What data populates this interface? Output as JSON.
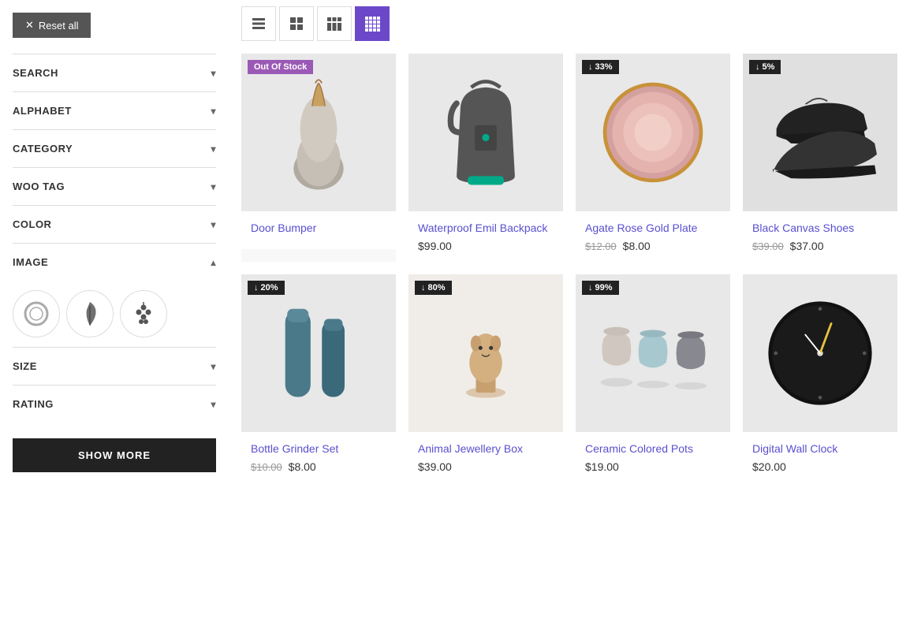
{
  "sidebar": {
    "reset_label": "Reset all",
    "filters": [
      {
        "id": "search",
        "label": "SEARCH",
        "expanded": false
      },
      {
        "id": "alphabet",
        "label": "ALPHABET",
        "expanded": false
      },
      {
        "id": "category",
        "label": "CATEGORY",
        "expanded": false
      },
      {
        "id": "woo-tag",
        "label": "WOO TAG",
        "expanded": false
      },
      {
        "id": "color",
        "label": "COLOR",
        "expanded": false
      },
      {
        "id": "image",
        "label": "IMAGE",
        "expanded": true
      },
      {
        "id": "size",
        "label": "SIZE",
        "expanded": false
      },
      {
        "id": "rating",
        "label": "RATING",
        "expanded": false
      }
    ],
    "show_more_label": "SHOW MORE"
  },
  "toolbar": {
    "views": [
      {
        "id": "list",
        "label": "List view"
      },
      {
        "id": "grid2",
        "label": "2-column grid"
      },
      {
        "id": "grid3",
        "label": "3-column grid"
      },
      {
        "id": "grid4",
        "label": "4-column grid",
        "active": true
      }
    ]
  },
  "products": [
    {
      "id": 1,
      "name": "Door Bumper",
      "price": null,
      "badge": "Out Of Stock",
      "badge_type": "out",
      "row": 1
    },
    {
      "id": 2,
      "name": "Waterproof Emil Backpack",
      "price": "$99.00",
      "badge": null,
      "row": 1
    },
    {
      "id": 3,
      "name": "Agate Rose Gold Plate",
      "original_price": "$12.00",
      "sale_price": "$8.00",
      "badge": "↓ 33%",
      "badge_type": "discount",
      "row": 1
    },
    {
      "id": 4,
      "name": "Black Canvas Shoes",
      "original_price": "$39.00",
      "sale_price": "$37.00",
      "badge": "↓ 5%",
      "badge_type": "discount",
      "row": 1
    },
    {
      "id": 5,
      "name": "Bottle Grinder Set",
      "original_price": "$10.00",
      "sale_price": "$8.00",
      "badge": "↓ 20%",
      "badge_type": "discount",
      "row": 2
    },
    {
      "id": 6,
      "name": "Animal Jewellery Box",
      "price": "$39.00",
      "badge": "↓ 80%",
      "badge_type": "discount",
      "row": 2
    },
    {
      "id": 7,
      "name": "Ceramic Colored Pots",
      "price": "$19.00",
      "badge": "↓ 99%",
      "badge_type": "discount",
      "row": 2
    },
    {
      "id": 8,
      "name": "Digital Wall Clock",
      "price": "$20.00",
      "badge": null,
      "row": 2
    }
  ],
  "colors": {
    "purple": "#6c48c9",
    "dark": "#222",
    "badge_out": "#9b59b6"
  }
}
